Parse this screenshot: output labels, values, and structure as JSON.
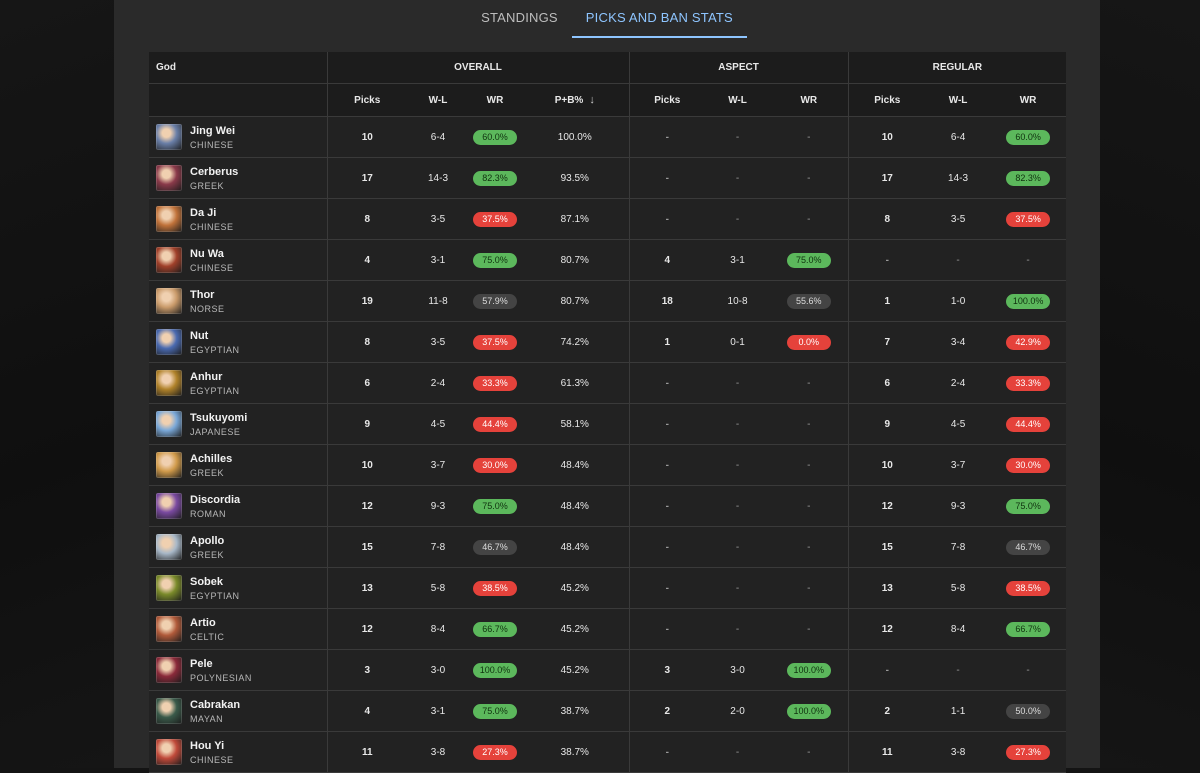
{
  "tabs": [
    {
      "label": "STANDINGS",
      "active": false
    },
    {
      "label": "PICKS AND BAN STATS",
      "active": true
    }
  ],
  "table": {
    "god_header": "God",
    "groups": [
      "OVERALL",
      "ASPECT",
      "REGULAR"
    ],
    "overall_cols": [
      "Picks",
      "W-L",
      "WR",
      "P+B%"
    ],
    "aspect_cols": [
      "Picks",
      "W-L",
      "WR"
    ],
    "regular_cols": [
      "Picks",
      "W-L",
      "WR"
    ],
    "sort_icon": "arrow-down-icon",
    "colors": {
      "green": "#5cb85c",
      "red": "#e5423b",
      "gray": "#444444",
      "accent": "#8ec5ff"
    },
    "rows": [
      {
        "name": "Jing Wei",
        "pantheon": "CHINESE",
        "avatar_color": "#6a7fa8",
        "o_picks": "10",
        "o_wl": "6-4",
        "o_wr": "60.0%",
        "o_wr_tone": "green",
        "o_pb": "100.0%",
        "a_picks": "-",
        "a_wl": "-",
        "a_wr": "-",
        "a_wr_tone": "",
        "r_picks": "10",
        "r_wl": "6-4",
        "r_wr": "60.0%",
        "r_wr_tone": "green"
      },
      {
        "name": "Cerberus",
        "pantheon": "GREEK",
        "avatar_color": "#8a3a4a",
        "o_picks": "17",
        "o_wl": "14-3",
        "o_wr": "82.3%",
        "o_wr_tone": "green",
        "o_pb": "93.5%",
        "a_picks": "-",
        "a_wl": "-",
        "a_wr": "-",
        "a_wr_tone": "",
        "r_picks": "17",
        "r_wl": "14-3",
        "r_wr": "82.3%",
        "r_wr_tone": "green"
      },
      {
        "name": "Da Ji",
        "pantheon": "CHINESE",
        "avatar_color": "#c0723a",
        "o_picks": "8",
        "o_wl": "3-5",
        "o_wr": "37.5%",
        "o_wr_tone": "red",
        "o_pb": "87.1%",
        "a_picks": "-",
        "a_wl": "-",
        "a_wr": "-",
        "a_wr_tone": "",
        "r_picks": "8",
        "r_wl": "3-5",
        "r_wr": "37.5%",
        "r_wr_tone": "red"
      },
      {
        "name": "Nu Wa",
        "pantheon": "CHINESE",
        "avatar_color": "#a0402a",
        "o_picks": "4",
        "o_wl": "3-1",
        "o_wr": "75.0%",
        "o_wr_tone": "green",
        "o_pb": "80.7%",
        "a_picks": "4",
        "a_wl": "3-1",
        "a_wr": "75.0%",
        "a_wr_tone": "green",
        "r_picks": "-",
        "r_wl": "-",
        "r_wr": "-",
        "r_wr_tone": ""
      },
      {
        "name": "Thor",
        "pantheon": "NORSE",
        "avatar_color": "#c99a6a",
        "o_picks": "19",
        "o_wl": "11-8",
        "o_wr": "57.9%",
        "o_wr_tone": "gray",
        "o_pb": "80.7%",
        "a_picks": "18",
        "a_wl": "10-8",
        "a_wr": "55.6%",
        "a_wr_tone": "gray",
        "r_picks": "1",
        "r_wl": "1-0",
        "r_wr": "100.0%",
        "r_wr_tone": "green"
      },
      {
        "name": "Nut",
        "pantheon": "EGYPTIAN",
        "avatar_color": "#4a6ab0",
        "o_picks": "8",
        "o_wl": "3-5",
        "o_wr": "37.5%",
        "o_wr_tone": "red",
        "o_pb": "74.2%",
        "a_picks": "1",
        "a_wl": "0-1",
        "a_wr": "0.0%",
        "a_wr_tone": "red",
        "r_picks": "7",
        "r_wl": "3-4",
        "r_wr": "42.9%",
        "r_wr_tone": "red"
      },
      {
        "name": "Anhur",
        "pantheon": "EGYPTIAN",
        "avatar_color": "#b0822a",
        "o_picks": "6",
        "o_wl": "2-4",
        "o_wr": "33.3%",
        "o_wr_tone": "red",
        "o_pb": "61.3%",
        "a_picks": "-",
        "a_wl": "-",
        "a_wr": "-",
        "a_wr_tone": "",
        "r_picks": "6",
        "r_wl": "2-4",
        "r_wr": "33.3%",
        "r_wr_tone": "red"
      },
      {
        "name": "Tsukuyomi",
        "pantheon": "JAPANESE",
        "avatar_color": "#7aa8d8",
        "o_picks": "9",
        "o_wl": "4-5",
        "o_wr": "44.4%",
        "o_wr_tone": "red",
        "o_pb": "58.1%",
        "a_picks": "-",
        "a_wl": "-",
        "a_wr": "-",
        "a_wr_tone": "",
        "r_picks": "9",
        "r_wl": "4-5",
        "r_wr": "44.4%",
        "r_wr_tone": "red"
      },
      {
        "name": "Achilles",
        "pantheon": "GREEK",
        "avatar_color": "#d09a4a",
        "o_picks": "10",
        "o_wl": "3-7",
        "o_wr": "30.0%",
        "o_wr_tone": "red",
        "o_pb": "48.4%",
        "a_picks": "-",
        "a_wl": "-",
        "a_wr": "-",
        "a_wr_tone": "",
        "r_picks": "10",
        "r_wl": "3-7",
        "r_wr": "30.0%",
        "r_wr_tone": "red"
      },
      {
        "name": "Discordia",
        "pantheon": "ROMAN",
        "avatar_color": "#7a4aa0",
        "o_picks": "12",
        "o_wl": "9-3",
        "o_wr": "75.0%",
        "o_wr_tone": "green",
        "o_pb": "48.4%",
        "a_picks": "-",
        "a_wl": "-",
        "a_wr": "-",
        "a_wr_tone": "",
        "r_picks": "12",
        "r_wl": "9-3",
        "r_wr": "75.0%",
        "r_wr_tone": "green"
      },
      {
        "name": "Apollo",
        "pantheon": "GREEK",
        "avatar_color": "#a8b8c8",
        "o_picks": "15",
        "o_wl": "7-8",
        "o_wr": "46.7%",
        "o_wr_tone": "gray",
        "o_pb": "48.4%",
        "a_picks": "-",
        "a_wl": "-",
        "a_wr": "-",
        "a_wr_tone": "",
        "r_picks": "15",
        "r_wl": "7-8",
        "r_wr": "46.7%",
        "r_wr_tone": "gray"
      },
      {
        "name": "Sobek",
        "pantheon": "EGYPTIAN",
        "avatar_color": "#7a8a2a",
        "o_picks": "13",
        "o_wl": "5-8",
        "o_wr": "38.5%",
        "o_wr_tone": "red",
        "o_pb": "45.2%",
        "a_picks": "-",
        "a_wl": "-",
        "a_wr": "-",
        "a_wr_tone": "",
        "r_picks": "13",
        "r_wl": "5-8",
        "r_wr": "38.5%",
        "r_wr_tone": "red"
      },
      {
        "name": "Artio",
        "pantheon": "CELTIC",
        "avatar_color": "#b05a3a",
        "o_picks": "12",
        "o_wl": "8-4",
        "o_wr": "66.7%",
        "o_wr_tone": "green",
        "o_pb": "45.2%",
        "a_picks": "-",
        "a_wl": "-",
        "a_wr": "-",
        "a_wr_tone": "",
        "r_picks": "12",
        "r_wl": "8-4",
        "r_wr": "66.7%",
        "r_wr_tone": "green"
      },
      {
        "name": "Pele",
        "pantheon": "POLYNESIAN",
        "avatar_color": "#8a2a3a",
        "o_picks": "3",
        "o_wl": "3-0",
        "o_wr": "100.0%",
        "o_wr_tone": "green",
        "o_pb": "45.2%",
        "a_picks": "3",
        "a_wl": "3-0",
        "a_wr": "100.0%",
        "a_wr_tone": "green",
        "r_picks": "-",
        "r_wl": "-",
        "r_wr": "-",
        "r_wr_tone": ""
      },
      {
        "name": "Cabrakan",
        "pantheon": "MAYAN",
        "avatar_color": "#3a5a4a",
        "o_picks": "4",
        "o_wl": "3-1",
        "o_wr": "75.0%",
        "o_wr_tone": "green",
        "o_pb": "38.7%",
        "a_picks": "2",
        "a_wl": "2-0",
        "a_wr": "100.0%",
        "a_wr_tone": "green",
        "r_picks": "2",
        "r_wl": "1-1",
        "r_wr": "50.0%",
        "r_wr_tone": "gray"
      },
      {
        "name": "Hou Yi",
        "pantheon": "CHINESE",
        "avatar_color": "#c04a3a",
        "o_picks": "11",
        "o_wl": "3-8",
        "o_wr": "27.3%",
        "o_wr_tone": "red",
        "o_pb": "38.7%",
        "a_picks": "-",
        "a_wl": "-",
        "a_wr": "-",
        "a_wr_tone": "",
        "r_picks": "11",
        "r_wl": "3-8",
        "r_wr": "27.3%",
        "r_wr_tone": "red"
      }
    ]
  }
}
